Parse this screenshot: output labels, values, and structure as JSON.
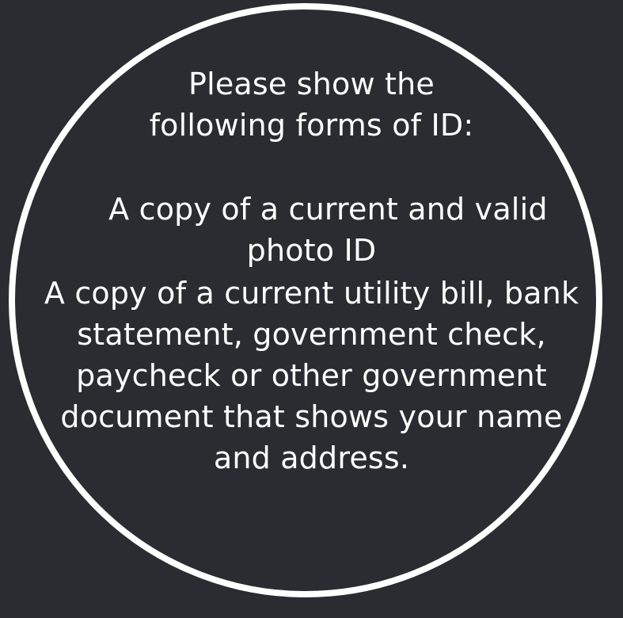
{
  "colors": {
    "background": "#2a2c31",
    "foreground": "#ffffff"
  },
  "heading": {
    "lines": [
      "Please show the",
      "following forms of ID:"
    ]
  },
  "requirements": [
    {
      "lines": [
        "A copy of a current and valid",
        "photo ID"
      ]
    },
    {
      "lines": [
        "A copy of a current utility bill, bank",
        "statement, government check,",
        "paycheck or other government",
        "document that shows your name",
        "and address."
      ]
    }
  ]
}
